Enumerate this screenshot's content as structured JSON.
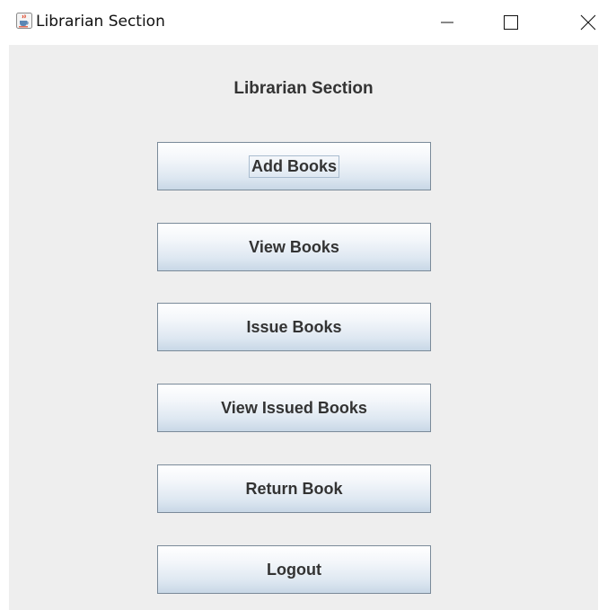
{
  "window": {
    "title": "Librarian Section",
    "icon": "java-cup-icon",
    "controls": [
      "minimize-icon",
      "maximize-icon",
      "close-icon"
    ]
  },
  "panel": {
    "heading": "Librarian Section",
    "buttons": [
      {
        "label": "Add Books",
        "focused": true
      },
      {
        "label": "View Books",
        "focused": false
      },
      {
        "label": "Issue Books",
        "focused": false
      },
      {
        "label": "View Issued Books",
        "focused": false
      },
      {
        "label": "Return Book",
        "focused": false
      },
      {
        "label": "Logout",
        "focused": false
      }
    ]
  },
  "colors": {
    "panel_background": "#eeeeee",
    "button_border": "#7a8a99",
    "button_gradient_top": "#ffffff",
    "button_gradient_bottom": "#c8d7e6",
    "text": "#333333"
  }
}
